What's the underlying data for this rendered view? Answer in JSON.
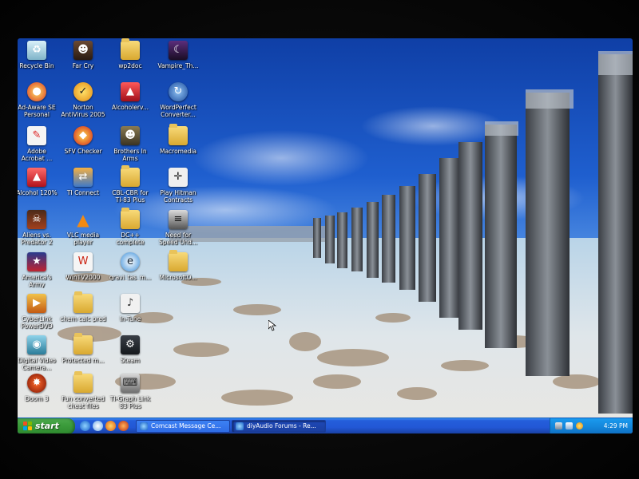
{
  "desktop": {
    "icons": [
      {
        "label": "Recycle Bin",
        "icon": "recycle-bin-icon"
      },
      {
        "label": "Far Cry",
        "icon": "far-cry-icon"
      },
      {
        "label": "wp2doc",
        "icon": "folder-icon"
      },
      {
        "label": "Vampire_Th...",
        "icon": "vampire-game-icon"
      },
      {
        "label": "Ad-Aware SE",
        "label2": "Personal",
        "icon": "ad-aware-icon"
      },
      {
        "label": "Norton",
        "label2": "AntiVirus 2005",
        "icon": "norton-antivirus-icon"
      },
      {
        "label": "Alcoholerv...",
        "icon": "alcohol-icon"
      },
      {
        "label": "WordPerfect",
        "label2": "Converter...",
        "icon": "wordperfect-icon"
      },
      {
        "label": "Adobe",
        "label2": "Acrobat ...",
        "icon": "adobe-acrobat-icon"
      },
      {
        "label": "SFV Checker",
        "icon": "sfv-checker-icon"
      },
      {
        "label": "Brothers In",
        "label2": "Arms",
        "icon": "brothers-in-arms-icon"
      },
      {
        "label": "Macromedia",
        "icon": "folder-icon"
      },
      {
        "label": "Alcohol 120%",
        "icon": "alcohol-120-icon"
      },
      {
        "label": "TI Connect",
        "icon": "ti-connect-icon"
      },
      {
        "label": "CBL-CBR for",
        "label2": "TI-83 Plus",
        "icon": "folder-icon"
      },
      {
        "label": "Play Hitman",
        "label2": "Contracts",
        "icon": "hitman-icon"
      },
      {
        "label": "Aliens vs.",
        "label2": "Predator 2",
        "icon": "aliens-vs-predator-icon"
      },
      {
        "label": "VLC media",
        "label2": "player",
        "icon": "vlc-icon"
      },
      {
        "label": "DC++",
        "label2": "complete",
        "icon": "folder-icon"
      },
      {
        "label": "Need for",
        "label2": "Speed Und...",
        "icon": "need-for-speed-icon"
      },
      {
        "label": "America's",
        "label2": "Army",
        "icon": "americas-army-icon"
      },
      {
        "label": "WinTV2000",
        "icon": "wintv-icon"
      },
      {
        "label": "gravi_tas_m...",
        "icon": "gravi-tas-icon"
      },
      {
        "label": "MicrosoftO...",
        "icon": "folder-icon"
      },
      {
        "label": "CyberLink",
        "label2": "PowerDVD",
        "icon": "powerdvd-icon"
      },
      {
        "label": "chem calc pred",
        "icon": "folder-icon"
      },
      {
        "label": "In-Tune",
        "icon": "in-tune-icon"
      },
      {
        "label": "Digital Video",
        "label2": "Camera...",
        "icon": "digital-video-camera-icon"
      },
      {
        "label": "Protected m...",
        "icon": "folder-icon"
      },
      {
        "label": "Steam",
        "icon": "steam-icon"
      },
      {
        "label": "Doom 3",
        "icon": "doom3-icon"
      },
      {
        "label": "Fun converted",
        "label2": "cheat files",
        "icon": "folder-icon"
      },
      {
        "label": "TI-Graph Link",
        "label2": "83 Plus",
        "icon": "ti-graph-link-icon"
      }
    ]
  },
  "taskbar": {
    "start_label": "start",
    "tasks": [
      {
        "label": "Comcast Message Ce...",
        "icon": "ie-icon",
        "active": false
      },
      {
        "label": "diyAudio Forums - Re...",
        "icon": "ie-icon",
        "active": true
      }
    ],
    "clock": "4:29 PM"
  },
  "colors": {
    "taskbar_blue": "#245edb",
    "start_green": "#3c9c3c",
    "tray_blue": "#1384d8",
    "sky_blue": "#1f5fcf"
  }
}
